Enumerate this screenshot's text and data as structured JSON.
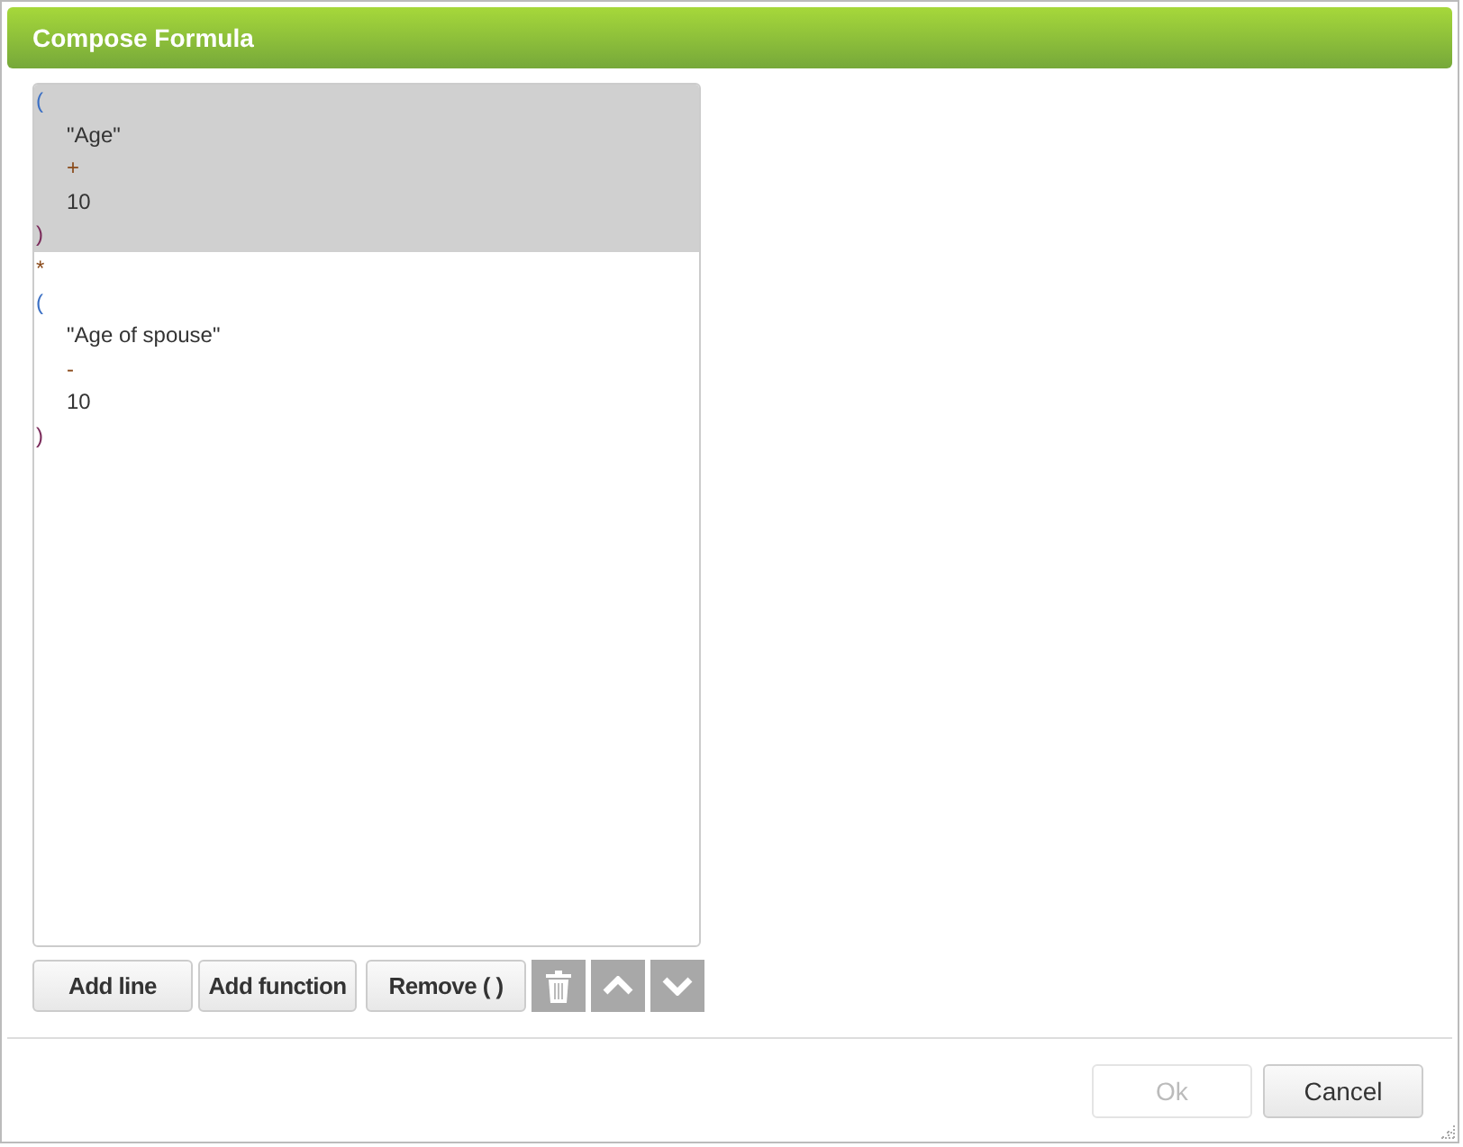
{
  "dialog": {
    "title": "Compose Formula"
  },
  "formula": {
    "blocks": [
      {
        "selected": true,
        "lines": [
          {
            "text": "(",
            "kind": "open",
            "children": [
              {
                "text": "\"Age\"",
                "kind": "operand"
              },
              {
                "text": "+",
                "kind": "operator"
              },
              {
                "text": "10",
                "kind": "operand"
              }
            ]
          },
          {
            "text": ")",
            "kind": "close"
          }
        ]
      },
      {
        "selected": false,
        "lines": [
          {
            "text": "*",
            "kind": "operator"
          },
          {
            "text": "(",
            "kind": "open",
            "children": [
              {
                "text": "\"Age of spouse\"",
                "kind": "operand"
              },
              {
                "text": "-",
                "kind": "operator"
              },
              {
                "text": "10",
                "kind": "operand"
              }
            ]
          },
          {
            "text": ")",
            "kind": "close"
          }
        ]
      }
    ]
  },
  "toolbar": [
    "Add line",
    "Add function",
    "Remove ( )"
  ],
  "footer_buttons": [
    {
      "label": "Ok",
      "disabled": true
    },
    {
      "label": "Cancel",
      "disabled": false
    }
  ]
}
